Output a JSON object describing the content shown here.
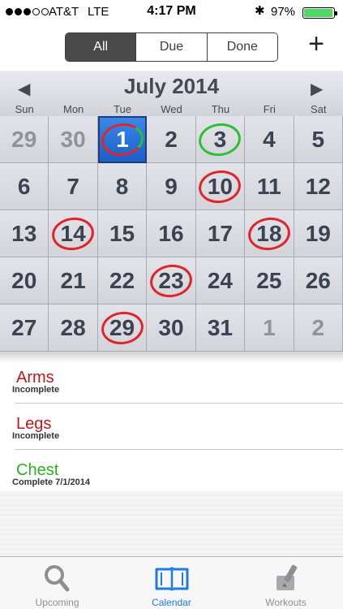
{
  "status_bar": {
    "carrier": "AT&T",
    "network": "LTE",
    "time": "4:17 PM",
    "battery_percent": "97%",
    "battery_level": 0.97
  },
  "filter": {
    "segments": [
      {
        "label": "All",
        "active": true
      },
      {
        "label": "Due",
        "active": false
      },
      {
        "label": "Done",
        "active": false
      }
    ],
    "add_label": "+"
  },
  "calendar": {
    "month_title": "July 2014",
    "prev_icon": "◀",
    "next_icon": "▶",
    "weekdays": [
      "Sun",
      "Mon",
      "Tue",
      "Wed",
      "Thu",
      "Fri",
      "Sat"
    ],
    "days": [
      {
        "label": "29",
        "muted": true,
        "mark": ""
      },
      {
        "label": "30",
        "muted": true,
        "mark": ""
      },
      {
        "label": "1",
        "muted": false,
        "mark": "split",
        "today": true
      },
      {
        "label": "2",
        "muted": false,
        "mark": ""
      },
      {
        "label": "3",
        "muted": false,
        "mark": "green"
      },
      {
        "label": "4",
        "muted": false,
        "mark": ""
      },
      {
        "label": "5",
        "muted": false,
        "mark": ""
      },
      {
        "label": "6",
        "muted": false,
        "mark": ""
      },
      {
        "label": "7",
        "muted": false,
        "mark": ""
      },
      {
        "label": "8",
        "muted": false,
        "mark": ""
      },
      {
        "label": "9",
        "muted": false,
        "mark": ""
      },
      {
        "label": "10",
        "muted": false,
        "mark": "red"
      },
      {
        "label": "11",
        "muted": false,
        "mark": ""
      },
      {
        "label": "12",
        "muted": false,
        "mark": ""
      },
      {
        "label": "13",
        "muted": false,
        "mark": ""
      },
      {
        "label": "14",
        "muted": false,
        "mark": "red"
      },
      {
        "label": "15",
        "muted": false,
        "mark": ""
      },
      {
        "label": "16",
        "muted": false,
        "mark": ""
      },
      {
        "label": "17",
        "muted": false,
        "mark": ""
      },
      {
        "label": "18",
        "muted": false,
        "mark": "red"
      },
      {
        "label": "19",
        "muted": false,
        "mark": ""
      },
      {
        "label": "20",
        "muted": false,
        "mark": ""
      },
      {
        "label": "21",
        "muted": false,
        "mark": ""
      },
      {
        "label": "22",
        "muted": false,
        "mark": ""
      },
      {
        "label": "23",
        "muted": false,
        "mark": "red"
      },
      {
        "label": "24",
        "muted": false,
        "mark": ""
      },
      {
        "label": "25",
        "muted": false,
        "mark": ""
      },
      {
        "label": "26",
        "muted": false,
        "mark": ""
      },
      {
        "label": "27",
        "muted": false,
        "mark": ""
      },
      {
        "label": "28",
        "muted": false,
        "mark": ""
      },
      {
        "label": "29",
        "muted": false,
        "mark": "red"
      },
      {
        "label": "30",
        "muted": false,
        "mark": ""
      },
      {
        "label": "31",
        "muted": false,
        "mark": ""
      },
      {
        "label": "1",
        "muted": true,
        "mark": ""
      },
      {
        "label": "2",
        "muted": true,
        "mark": ""
      }
    ]
  },
  "workouts": [
    {
      "name": "Arms",
      "status": "Incomplete",
      "color": "#c0161c"
    },
    {
      "name": "Legs",
      "status": "Incomplete",
      "color": "#c0161c"
    },
    {
      "name": "Chest",
      "status": "Complete 7/1/2014",
      "color": "#2fae1f"
    }
  ],
  "tabs": [
    {
      "label": "Upcoming",
      "icon": "magnifier-icon",
      "active": false
    },
    {
      "label": "Calendar",
      "icon": "open-book-icon",
      "active": true
    },
    {
      "label": "Workouts",
      "icon": "pencil-note-icon",
      "active": false
    }
  ],
  "colors": {
    "accent": "#1e7be6",
    "incomplete": "#c0161c",
    "complete": "#2fae1f",
    "today": "#2a72d8"
  }
}
